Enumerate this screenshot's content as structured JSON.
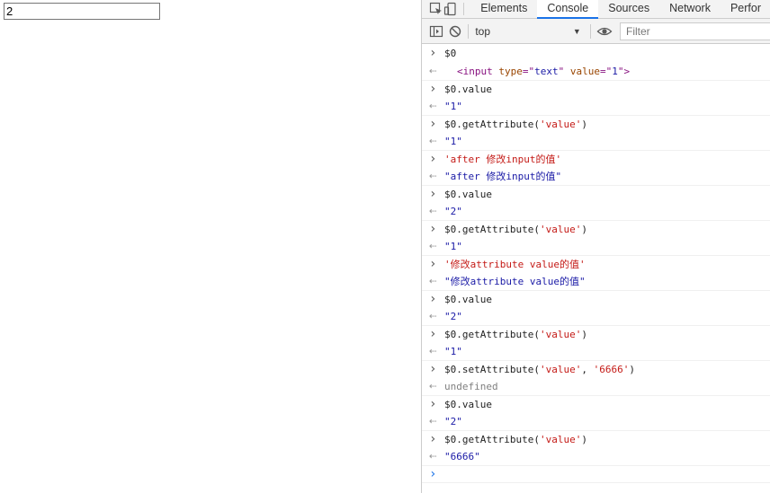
{
  "page": {
    "input_value": "2"
  },
  "devtools": {
    "tabs": [
      {
        "label": "Elements",
        "active": false
      },
      {
        "label": "Console",
        "active": true
      },
      {
        "label": "Sources",
        "active": false
      },
      {
        "label": "Network",
        "active": false
      },
      {
        "label": "Perfor",
        "active": false
      }
    ],
    "toolbar": {
      "context": "top",
      "filter_placeholder": "Filter"
    },
    "console": [
      {
        "type": "in",
        "parts": [
          {
            "t": "$0",
            "c": "code"
          }
        ]
      },
      {
        "type": "out",
        "parts": [
          {
            "t": "<",
            "c": "html"
          },
          {
            "t": "input",
            "c": "html"
          },
          {
            "t": " type",
            "c": "attr"
          },
          {
            "t": "=\"",
            "c": "html"
          },
          {
            "t": "text",
            "c": "attrval"
          },
          {
            "t": "\"",
            "c": "html"
          },
          {
            "t": " value",
            "c": "attr"
          },
          {
            "t": "=\"",
            "c": "html"
          },
          {
            "t": "1",
            "c": "attrval"
          },
          {
            "t": "\">",
            "c": "html"
          }
        ],
        "html": true
      },
      {
        "type": "in",
        "parts": [
          {
            "t": "$0.value",
            "c": "code"
          }
        ]
      },
      {
        "type": "out",
        "parts": [
          {
            "t": "\"1\"",
            "c": "str"
          }
        ]
      },
      {
        "type": "in",
        "parts": [
          {
            "t": "$0.getAttribute(",
            "c": "code"
          },
          {
            "t": "'value'",
            "c": "jsstr"
          },
          {
            "t": ")",
            "c": "code"
          }
        ]
      },
      {
        "type": "out",
        "parts": [
          {
            "t": "\"1\"",
            "c": "str"
          }
        ]
      },
      {
        "type": "in",
        "parts": [
          {
            "t": "'after 修改input的值'",
            "c": "jsstr"
          }
        ]
      },
      {
        "type": "out",
        "parts": [
          {
            "t": "\"after 修改input的值\"",
            "c": "str"
          }
        ]
      },
      {
        "type": "in",
        "parts": [
          {
            "t": "$0.value",
            "c": "code"
          }
        ]
      },
      {
        "type": "out",
        "parts": [
          {
            "t": "\"2\"",
            "c": "str"
          }
        ]
      },
      {
        "type": "in",
        "parts": [
          {
            "t": "$0.getAttribute(",
            "c": "code"
          },
          {
            "t": "'value'",
            "c": "jsstr"
          },
          {
            "t": ")",
            "c": "code"
          }
        ]
      },
      {
        "type": "out",
        "parts": [
          {
            "t": "\"1\"",
            "c": "str"
          }
        ]
      },
      {
        "type": "in",
        "parts": [
          {
            "t": "'修改attribute value的值'",
            "c": "jsstr"
          }
        ]
      },
      {
        "type": "out",
        "parts": [
          {
            "t": "\"修改attribute value的值\"",
            "c": "str"
          }
        ]
      },
      {
        "type": "in",
        "parts": [
          {
            "t": "$0.value",
            "c": "code"
          }
        ]
      },
      {
        "type": "out",
        "parts": [
          {
            "t": "\"2\"",
            "c": "str"
          }
        ]
      },
      {
        "type": "in",
        "parts": [
          {
            "t": "$0.getAttribute(",
            "c": "code"
          },
          {
            "t": "'value'",
            "c": "jsstr"
          },
          {
            "t": ")",
            "c": "code"
          }
        ]
      },
      {
        "type": "out",
        "parts": [
          {
            "t": "\"1\"",
            "c": "str"
          }
        ]
      },
      {
        "type": "in",
        "parts": [
          {
            "t": "$0.setAttribute(",
            "c": "code"
          },
          {
            "t": "'value'",
            "c": "jsstr"
          },
          {
            "t": ", ",
            "c": "code"
          },
          {
            "t": "'6666'",
            "c": "jsstr"
          },
          {
            "t": ")",
            "c": "code"
          }
        ]
      },
      {
        "type": "out",
        "parts": [
          {
            "t": "undefined",
            "c": "undef"
          }
        ]
      },
      {
        "type": "in",
        "parts": [
          {
            "t": "$0.value",
            "c": "code"
          }
        ]
      },
      {
        "type": "out",
        "parts": [
          {
            "t": "\"2\"",
            "c": "str"
          }
        ]
      },
      {
        "type": "in",
        "parts": [
          {
            "t": "$0.getAttribute(",
            "c": "code"
          },
          {
            "t": "'value'",
            "c": "jsstr"
          },
          {
            "t": ")",
            "c": "code"
          }
        ]
      },
      {
        "type": "out",
        "parts": [
          {
            "t": "\"6666\"",
            "c": "str"
          }
        ]
      },
      {
        "type": "prompt",
        "parts": []
      }
    ]
  }
}
